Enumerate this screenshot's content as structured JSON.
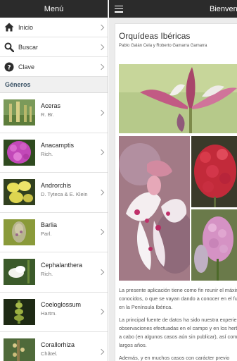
{
  "drawer": {
    "title": "Menú",
    "nav": [
      {
        "label": "Inicio",
        "icon": "home-icon"
      },
      {
        "label": "Buscar",
        "icon": "search-icon"
      },
      {
        "label": "Clave",
        "icon": "help-icon"
      }
    ],
    "section_title": "Géneros",
    "genera": [
      {
        "name": "Aceras",
        "author": "R. Br."
      },
      {
        "name": "Anacamptis",
        "author": "Rich."
      },
      {
        "name": "Androrchis",
        "author": "D. Tyteca & E. Klein"
      },
      {
        "name": "Barlia",
        "author": "Parl."
      },
      {
        "name": "Cephalanthera",
        "author": "Rich."
      },
      {
        "name": "Coeloglossum",
        "author": "Hartm."
      },
      {
        "name": "Corallorhiza",
        "author": "Châtel."
      }
    ]
  },
  "main": {
    "bar_title": "Bienvenido",
    "title": "Orquídeas Ibéricas",
    "authors": "Pablo Galán Cela y Roberto Gamarra Gamarra",
    "paragraphs": [
      [
        "La presente aplicación tiene como fin reunir el máximo",
        "conocidos, o que se vayan dando a conocer en el futuro,",
        "en la Península Ibérica."
      ],
      [
        "La principal fuente de datos ha sido nuestra experiencia",
        "observaciones efectuadas en el campo y en los herbarios",
        "a cabo (en algunos casos aún sin publicar), así como",
        "largos años."
      ],
      [
        "Además, y en muchos casos con carácter previo"
      ]
    ]
  },
  "colors": {
    "topbar": "#2b2b2b",
    "section_text": "#3b5366",
    "background": "#ececec"
  }
}
